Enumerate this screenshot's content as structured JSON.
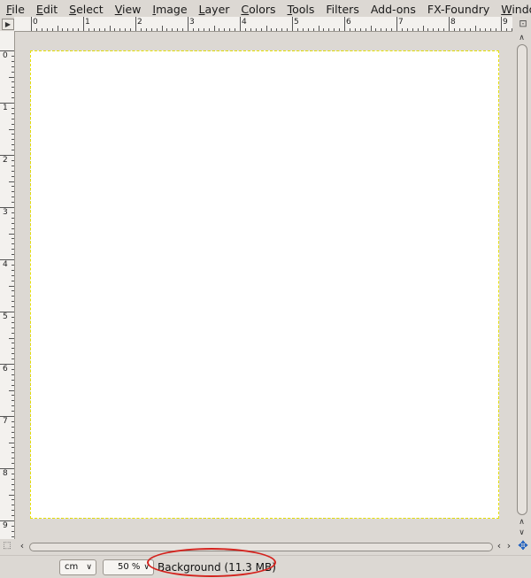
{
  "menubar": {
    "items": [
      {
        "u": "F",
        "rest": "ile"
      },
      {
        "u": "E",
        "rest": "dit"
      },
      {
        "u": "S",
        "rest": "elect"
      },
      {
        "u": "V",
        "rest": "iew"
      },
      {
        "u": "I",
        "rest": "mage"
      },
      {
        "u": "L",
        "rest": "ayer"
      },
      {
        "u": "C",
        "rest": "olors"
      },
      {
        "u": "T",
        "rest": "ools"
      },
      {
        "u": "",
        "rest": "Filters"
      },
      {
        "u": "",
        "rest": "Add-ons"
      },
      {
        "u": "",
        "rest": "FX-Foundry"
      },
      {
        "u": "W",
        "rest": "indows"
      }
    ]
  },
  "ruler": {
    "horizontal_labels": [
      "0",
      "1",
      "2",
      "3",
      "4",
      "5",
      "6",
      "7",
      "8",
      "9"
    ],
    "vertical_labels": [
      "0",
      "1",
      "2",
      "3",
      "4",
      "5",
      "6",
      "7",
      "8",
      "9"
    ]
  },
  "statusbar": {
    "unit": "cm",
    "zoom": "50 %",
    "layer_info": "Background (11.3 MB)"
  },
  "colors": {
    "highlight": "#d4231e",
    "selection_dash": "#e7e100"
  },
  "icons": {
    "nav": "play-triangle",
    "zoom_corner": "zoom-icon",
    "quickmask": "quickmask-icon",
    "navigate": "navigate-cross-icon"
  }
}
